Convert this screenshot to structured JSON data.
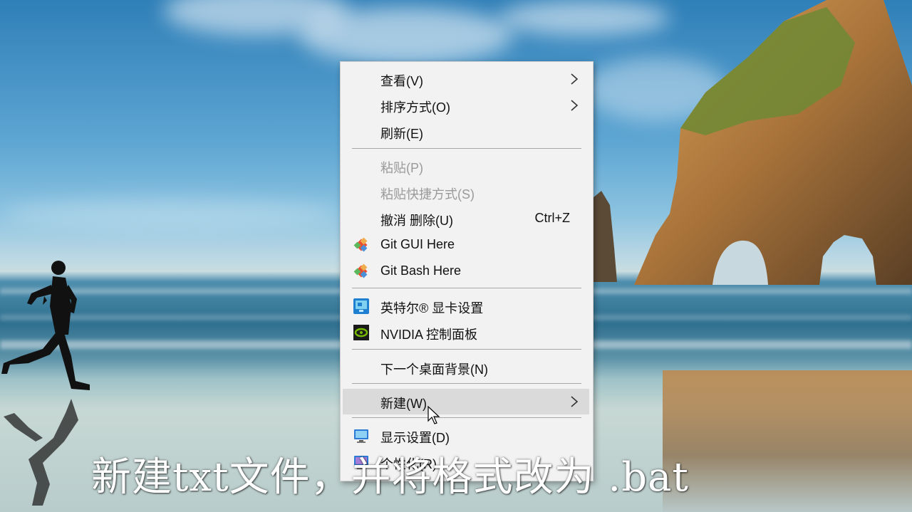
{
  "menu": {
    "items": [
      {
        "label": "查看(V)",
        "has_submenu": true,
        "state": "enabled"
      },
      {
        "label": "排序方式(O)",
        "has_submenu": true,
        "state": "enabled"
      },
      {
        "label": "刷新(E)",
        "state": "enabled"
      },
      {
        "label": "粘贴(P)",
        "state": "disabled"
      },
      {
        "label": "粘贴快捷方式(S)",
        "state": "disabled"
      },
      {
        "label": "撤消 删除(U)",
        "shortcut": "Ctrl+Z",
        "state": "enabled"
      },
      {
        "label": "Git GUI Here",
        "icon": "git-gui-icon",
        "state": "enabled"
      },
      {
        "label": "Git Bash Here",
        "icon": "git-bash-icon",
        "state": "enabled"
      },
      {
        "label": "英特尔® 显卡设置",
        "icon": "intel-graphics-icon",
        "state": "enabled"
      },
      {
        "label": "NVIDIA 控制面板",
        "icon": "nvidia-icon",
        "state": "enabled"
      },
      {
        "label": "下一个桌面背景(N)",
        "state": "enabled"
      },
      {
        "label": "新建(W)",
        "has_submenu": true,
        "state": "hovered"
      },
      {
        "label": "显示设置(D)",
        "icon": "display-settings-icon",
        "state": "enabled"
      },
      {
        "label": "个性化(R)",
        "icon": "personalize-icon",
        "state": "enabled"
      }
    ]
  },
  "caption": "新建txt文件，并将格式改为 .bat",
  "colors": {
    "menu_bg": "#f2f2f2",
    "hover_bg": "#dadada",
    "disabled_text": "#9a9a9a",
    "separator": "#a7a7a7"
  }
}
